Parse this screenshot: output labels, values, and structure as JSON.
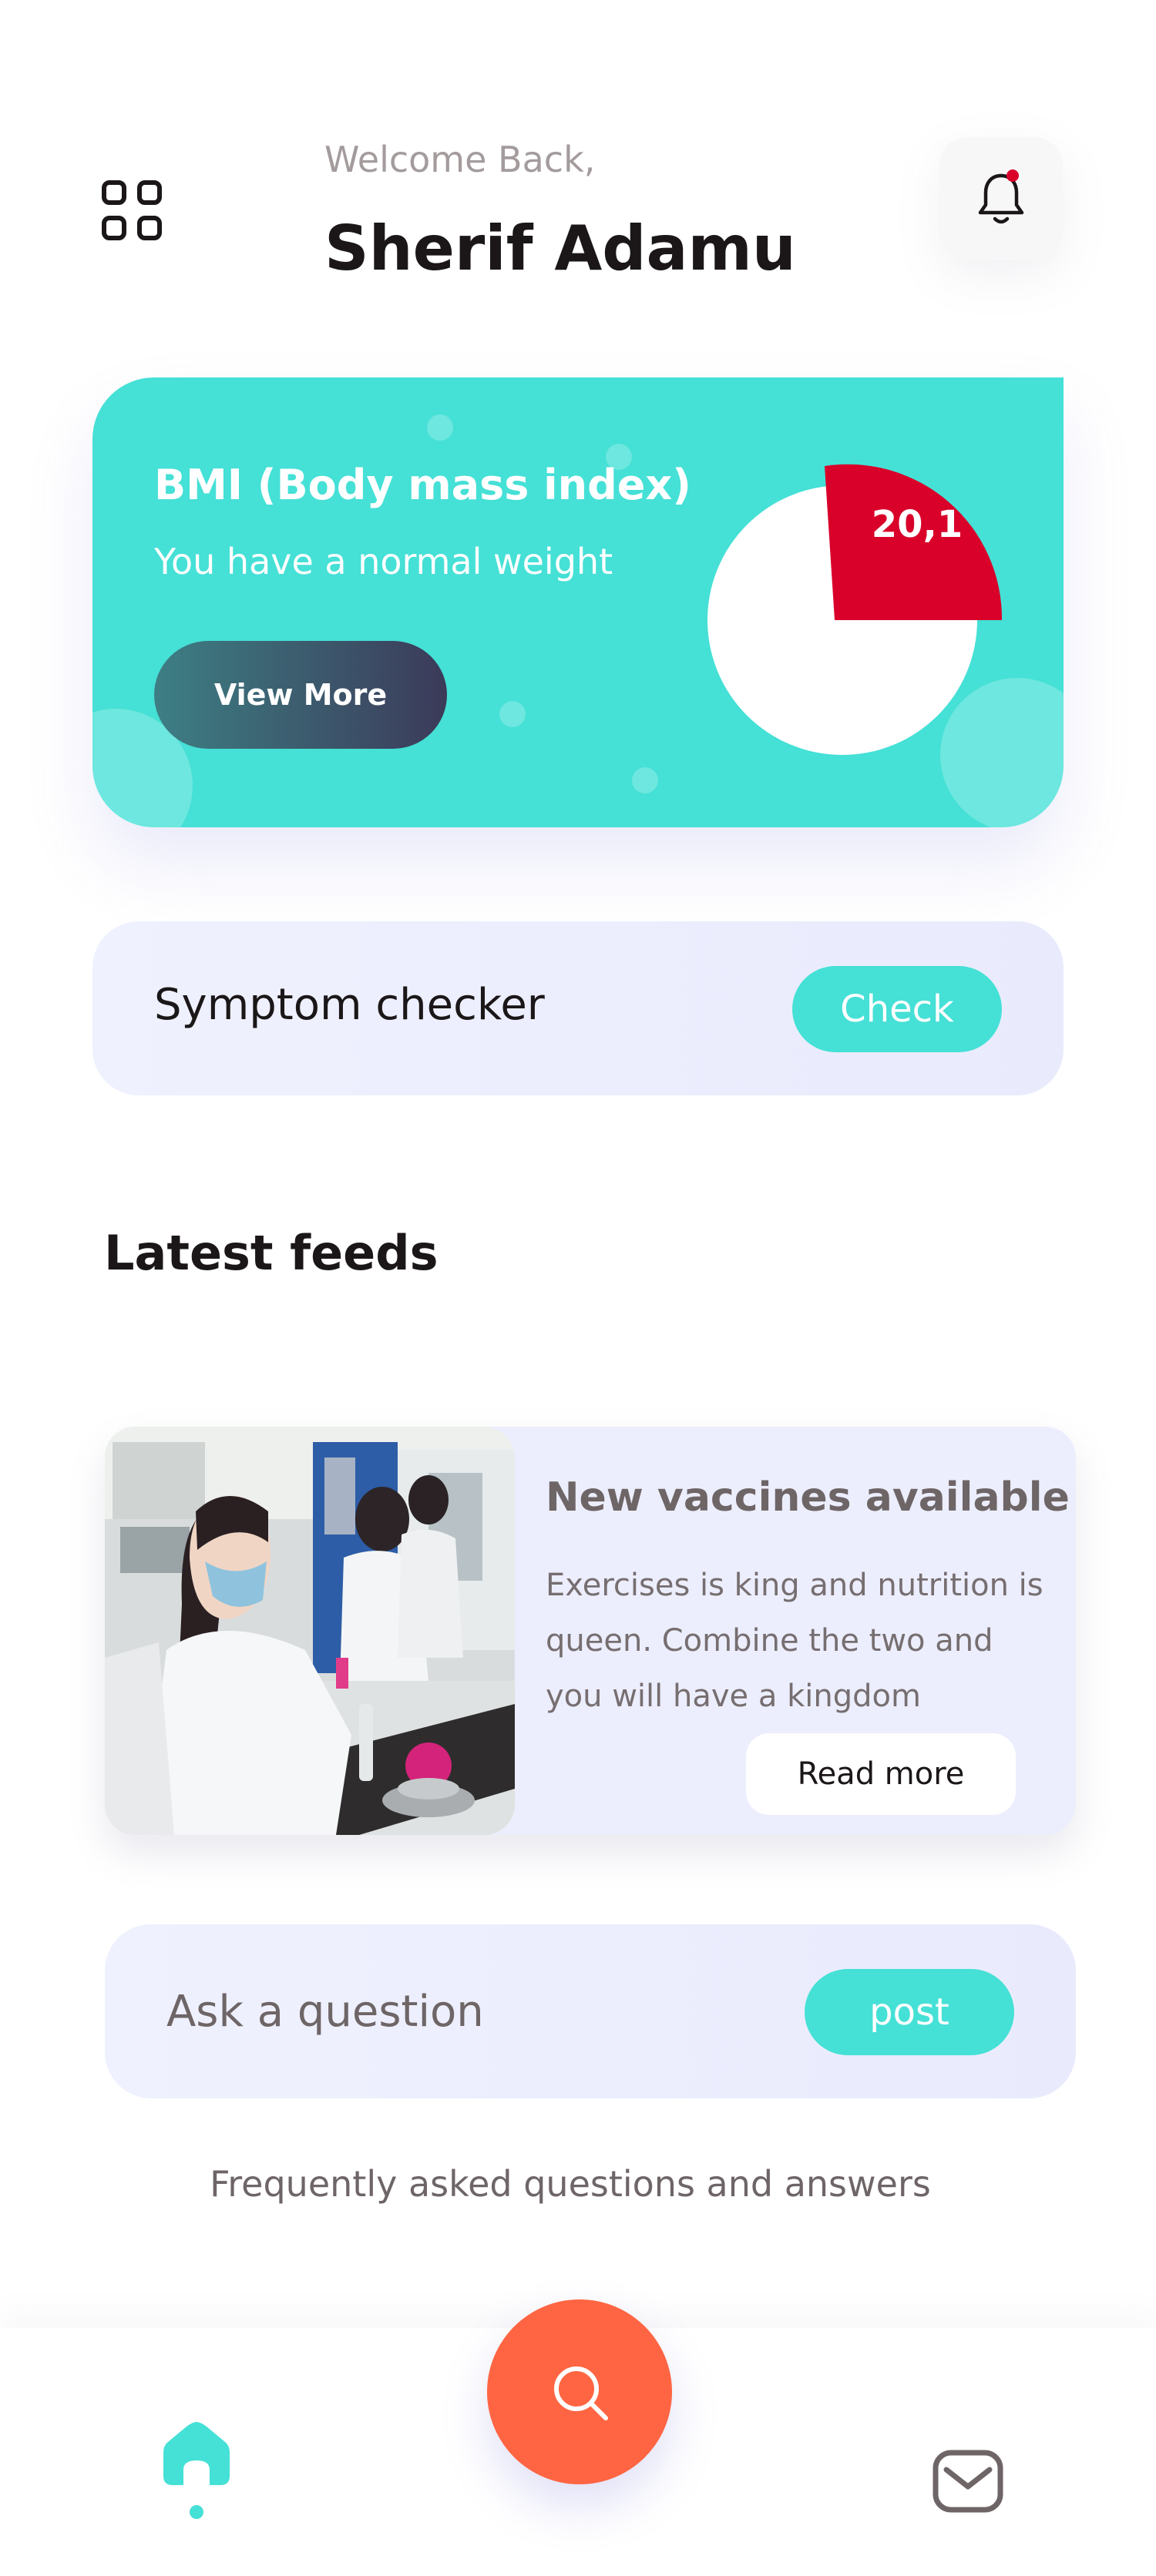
{
  "header": {
    "welcome_text": "Welcome Back,",
    "user_name": "Sherif Adamu",
    "menu_icon": "grid-menu-icon",
    "notification_icon": "bell-icon",
    "has_unread_notification": true
  },
  "bmi_card": {
    "title": "BMI (Body mass index)",
    "subtitle": "You have a normal weight",
    "button_label": "View More",
    "value_label": "20,1"
  },
  "symptom_checker": {
    "label": "Symptom checker",
    "button_label": "Check"
  },
  "feeds": {
    "section_title": "Latest feeds",
    "items": [
      {
        "title": "New vaccines available",
        "body": "Exercises is king and nutrition is queen. Combine the two and you will have a kingdom",
        "button_label": "Read more"
      }
    ]
  },
  "ask": {
    "placeholder": "Ask a question",
    "button_label": "post"
  },
  "faq_link": "Frequently asked questions and answers",
  "bottom_nav": {
    "items": [
      {
        "icon": "home-icon",
        "active": true
      },
      {
        "icon": "search-icon",
        "active": false
      },
      {
        "icon": "mail-icon",
        "active": false
      }
    ]
  },
  "colors": {
    "accent": "#45e0d6",
    "alert": "#d9002a",
    "fab": "#ff6542",
    "card_bg": "#eceefd",
    "text_dark": "#1b1718",
    "text_muted": "#6e6567"
  }
}
